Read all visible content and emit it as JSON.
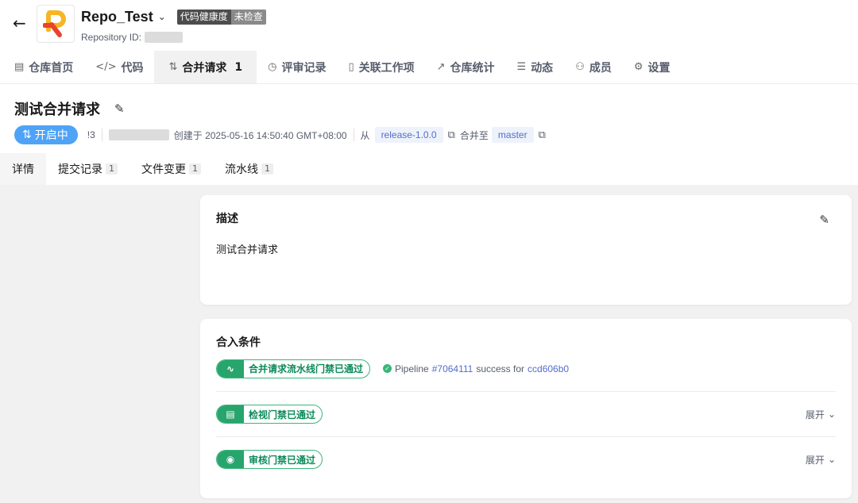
{
  "header": {
    "back_icon": "arrow-left-icon",
    "repo_name": "Repo_Test",
    "health_label": "代码健康度",
    "health_status": "未检查",
    "repo_id_label": "Repository ID:"
  },
  "nav": [
    {
      "label": "仓库首页",
      "icon": "▤"
    },
    {
      "label": "代码",
      "icon": "</>"
    },
    {
      "label": "合并请求",
      "icon": "⇅",
      "count": "1"
    },
    {
      "label": "评审记录",
      "icon": "◷"
    },
    {
      "label": "关联工作项",
      "icon": "▯"
    },
    {
      "label": "仓库统计",
      "icon": "↗"
    },
    {
      "label": "动态",
      "icon": "☰"
    },
    {
      "label": "成员",
      "icon": "⚇"
    },
    {
      "label": "设置",
      "icon": "⚙"
    }
  ],
  "mr": {
    "title": "测试合并请求",
    "status": "开启中",
    "iid": "!3",
    "created": "创建于 2025-05-16 14:50:40 GMT+08:00",
    "from_label": "从",
    "source_branch": "release-1.0.0",
    "merge_to_label": "合并至",
    "target_branch": "master"
  },
  "subtabs": [
    {
      "label": "详情"
    },
    {
      "label": "提交记录",
      "count": "1"
    },
    {
      "label": "文件变更",
      "count": "1"
    },
    {
      "label": "流水线",
      "count": "1"
    }
  ],
  "description": {
    "title": "描述",
    "body": "测试合并请求"
  },
  "conditions": {
    "title": "合入条件",
    "pipeline_gate": "合并请求流水线门禁已通过",
    "pipeline_prefix": "Pipeline",
    "pipeline_id": "#7064111",
    "pipeline_mid": "success for",
    "pipeline_commit": "ccd606b0",
    "review_gate": "检视门禁已通过",
    "approve_gate": "审核门禁已通过",
    "expand_label": "展开"
  },
  "colors": {
    "accent": "#4fa3f7",
    "success": "#27a56d",
    "link": "#526ecc"
  }
}
